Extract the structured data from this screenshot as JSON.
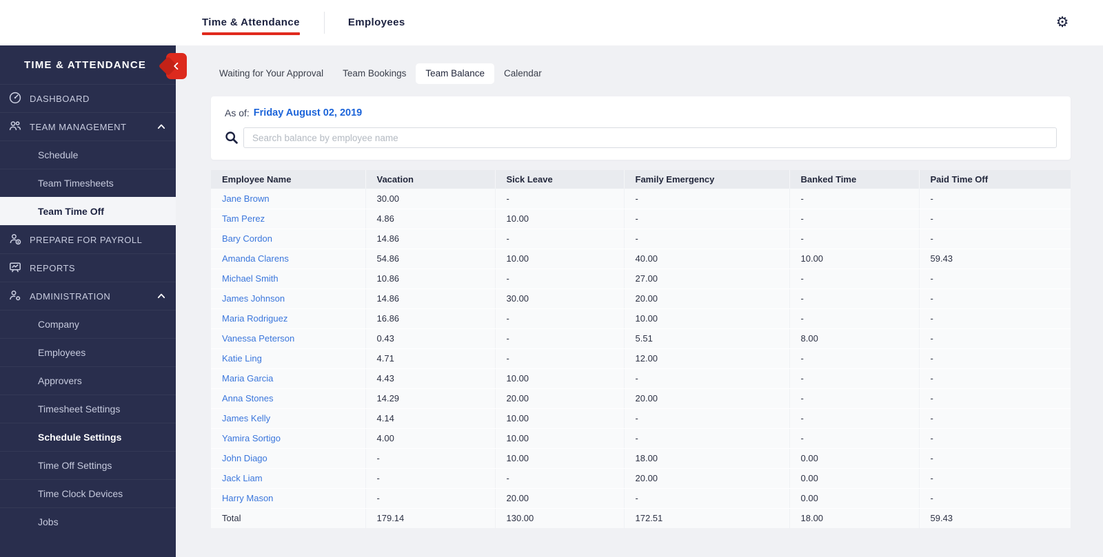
{
  "topbar": {
    "tabs": [
      {
        "label": "Time & Attendance",
        "active": true
      },
      {
        "label": "Employees",
        "active": false
      }
    ]
  },
  "sidebar": {
    "title": "TIME & ATTENDANCE",
    "items": [
      {
        "label": "DASHBOARD",
        "type": "top",
        "icon": "dashboard-icon"
      },
      {
        "label": "TEAM MANAGEMENT",
        "type": "top",
        "icon": "team-icon",
        "expanded": true
      },
      {
        "label": "Schedule",
        "type": "sub"
      },
      {
        "label": "Team Timesheets",
        "type": "sub"
      },
      {
        "label": "Team Time Off",
        "type": "sub",
        "active": true
      },
      {
        "label": "PREPARE FOR PAYROLL",
        "type": "top",
        "icon": "payroll-icon"
      },
      {
        "label": "REPORTS",
        "type": "top",
        "icon": "reports-icon"
      },
      {
        "label": "ADMINISTRATION",
        "type": "top",
        "icon": "admin-icon",
        "expanded": true
      },
      {
        "label": "Company",
        "type": "sub"
      },
      {
        "label": "Employees",
        "type": "sub"
      },
      {
        "label": "Approvers",
        "type": "sub"
      },
      {
        "label": "Timesheet Settings",
        "type": "sub"
      },
      {
        "label": "Schedule Settings",
        "type": "sub",
        "bold": true
      },
      {
        "label": "Time Off Settings",
        "type": "sub"
      },
      {
        "label": "Time Clock Devices",
        "type": "sub"
      },
      {
        "label": "Jobs",
        "type": "sub"
      }
    ]
  },
  "content": {
    "tabs": [
      "Waiting for Your Approval",
      "Team Bookings",
      "Team Balance",
      "Calendar"
    ],
    "active_tab_index": 2,
    "as_of_label": "As of:",
    "as_of_date": "Friday August 02, 2019",
    "search": {
      "placeholder": "Search balance by employee name"
    },
    "table": {
      "columns": [
        "Employee Name",
        "Vacation",
        "Sick Leave",
        "Family Emergency",
        "Banked Time",
        "Paid Time Off"
      ],
      "rows": [
        [
          "Jane Brown",
          "30.00",
          "-",
          "-",
          "-",
          "-"
        ],
        [
          "Tam Perez",
          "4.86",
          "10.00",
          "-",
          "-",
          "-"
        ],
        [
          "Bary Cordon",
          "14.86",
          "-",
          "-",
          "-",
          "-"
        ],
        [
          "Amanda Clarens",
          "54.86",
          "10.00",
          "40.00",
          "10.00",
          "59.43"
        ],
        [
          "Michael Smith",
          "10.86",
          "-",
          "27.00",
          "-",
          "-"
        ],
        [
          "James Johnson",
          "14.86",
          "30.00",
          "20.00",
          "-",
          "-"
        ],
        [
          "Maria Rodriguez",
          "16.86",
          "-",
          "10.00",
          "-",
          "-"
        ],
        [
          "Vanessa Peterson",
          "0.43",
          "-",
          "5.51",
          "8.00",
          "-"
        ],
        [
          "Katie Ling",
          "4.71",
          "-",
          "12.00",
          "-",
          "-"
        ],
        [
          "Maria Garcia",
          "4.43",
          "10.00",
          "-",
          "-",
          "-"
        ],
        [
          "Anna Stones",
          "14.29",
          "20.00",
          "20.00",
          "-",
          "-"
        ],
        [
          "James Kelly",
          "4.14",
          "10.00",
          "-",
          "-",
          "-"
        ],
        [
          "Yamira Sortigo",
          "4.00",
          "10.00",
          "-",
          "-",
          "-"
        ],
        [
          "John Diago",
          "-",
          "10.00",
          "18.00",
          "0.00",
          "-"
        ],
        [
          "Jack Liam",
          "-",
          "-",
          "20.00",
          "0.00",
          "-"
        ],
        [
          "Harry Mason",
          "-",
          "20.00",
          "-",
          "0.00",
          "-"
        ]
      ],
      "total_row": [
        "Total",
        "179.14",
        "130.00",
        "172.51",
        "18.00",
        "59.43"
      ]
    }
  },
  "colors": {
    "accent_red": "#dd2a1d",
    "sidebar_navy": "#292e4d",
    "link_blue": "#3a76dc",
    "date_blue": "#1c64d9",
    "header_gray": "#e9ebef",
    "page_bg": "#f0f1f4"
  }
}
